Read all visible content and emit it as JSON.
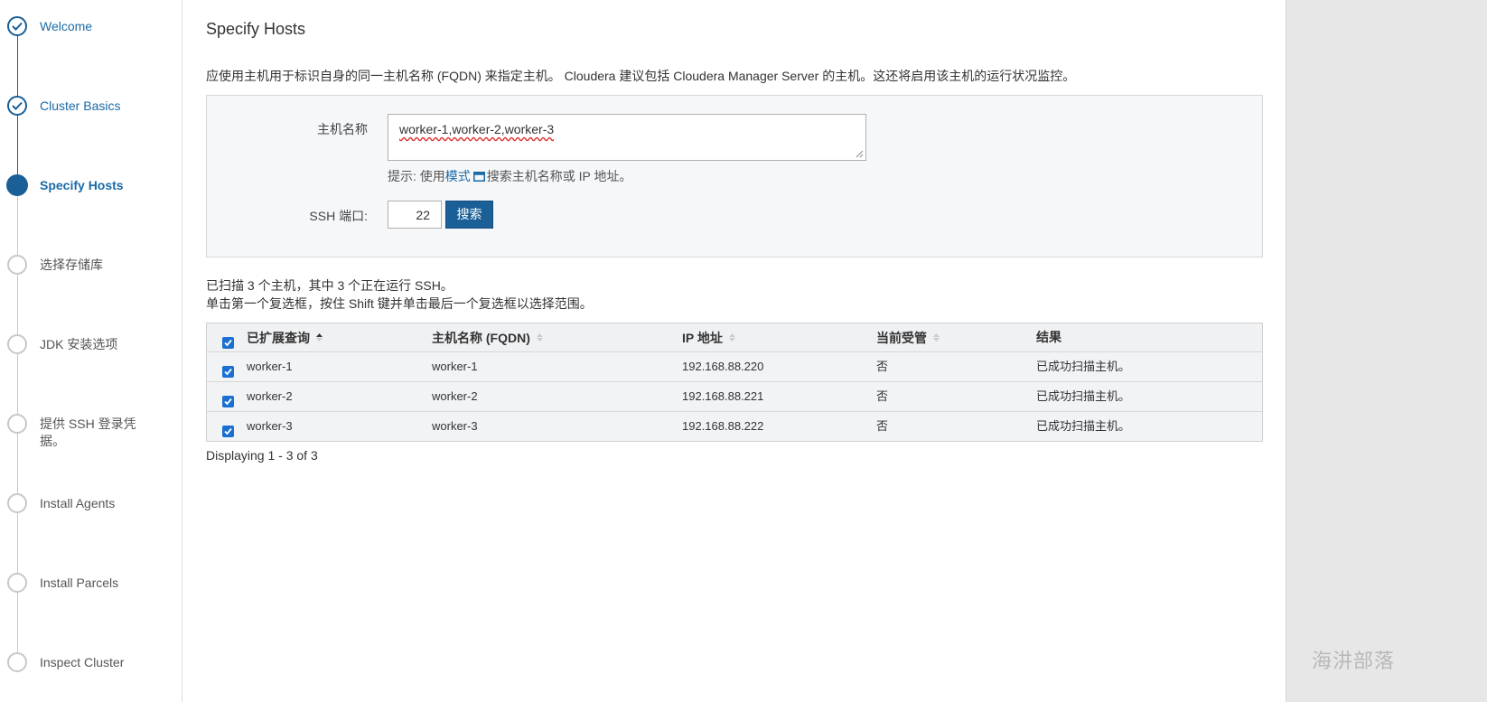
{
  "sidebar": {
    "steps": [
      {
        "label": "Welcome",
        "state": "done"
      },
      {
        "label": "Cluster Basics",
        "state": "done"
      },
      {
        "label": "Specify Hosts",
        "state": "active"
      },
      {
        "label": "选择存储库",
        "state": "pending"
      },
      {
        "label": "JDK 安装选项",
        "state": "pending"
      },
      {
        "label": "提供 SSH 登录凭据。",
        "state": "pending"
      },
      {
        "label": "Install Agents",
        "state": "pending"
      },
      {
        "label": "Install Parcels",
        "state": "pending"
      },
      {
        "label": "Inspect Cluster",
        "state": "pending"
      }
    ]
  },
  "main": {
    "title": "Specify Hosts",
    "description": "应使用主机用于标识自身的同一主机名称 (FQDN) 来指定主机。 Cloudera 建议包括 Cloudera Manager Server 的主机。这还将启用该主机的运行状况监控。",
    "form": {
      "host_label": "主机名称",
      "host_value": "worker-1,worker-2,worker-3",
      "hint_prefix": "提示: 使用",
      "hint_link": "模式",
      "hint_suffix": "搜索主机名称或 IP 地址。",
      "ssh_label": "SSH 端口:",
      "ssh_value": "22",
      "search_button": "搜索"
    },
    "scan_summary": "已扫描 3 个主机，其中 3 个正在运行 SSH。",
    "scan_tip": "单击第一个复选框，按住 Shift 键并单击最后一个复选框以选择范围。",
    "table": {
      "headers": {
        "expanded_query": "已扩展查询",
        "hostname": "主机名称 (FQDN)",
        "ip": "IP 地址",
        "managed": "当前受管",
        "result": "结果"
      },
      "rows": [
        {
          "query": "worker-1",
          "hostname": "worker-1",
          "ip": "192.168.88.220",
          "managed": "否",
          "result": "已成功扫描主机。"
        },
        {
          "query": "worker-2",
          "hostname": "worker-2",
          "ip": "192.168.88.221",
          "managed": "否",
          "result": "已成功扫描主机。"
        },
        {
          "query": "worker-3",
          "hostname": "worker-3",
          "ip": "192.168.88.222",
          "managed": "否",
          "result": "已成功扫描主机。"
        }
      ]
    },
    "footer": "Displaying 1 - 3 of 3"
  },
  "watermark": "海汫部落",
  "colors": {
    "accent": "#1a5f96",
    "checkbox": "#1a6fd0",
    "panel": "#e7e7e7"
  }
}
